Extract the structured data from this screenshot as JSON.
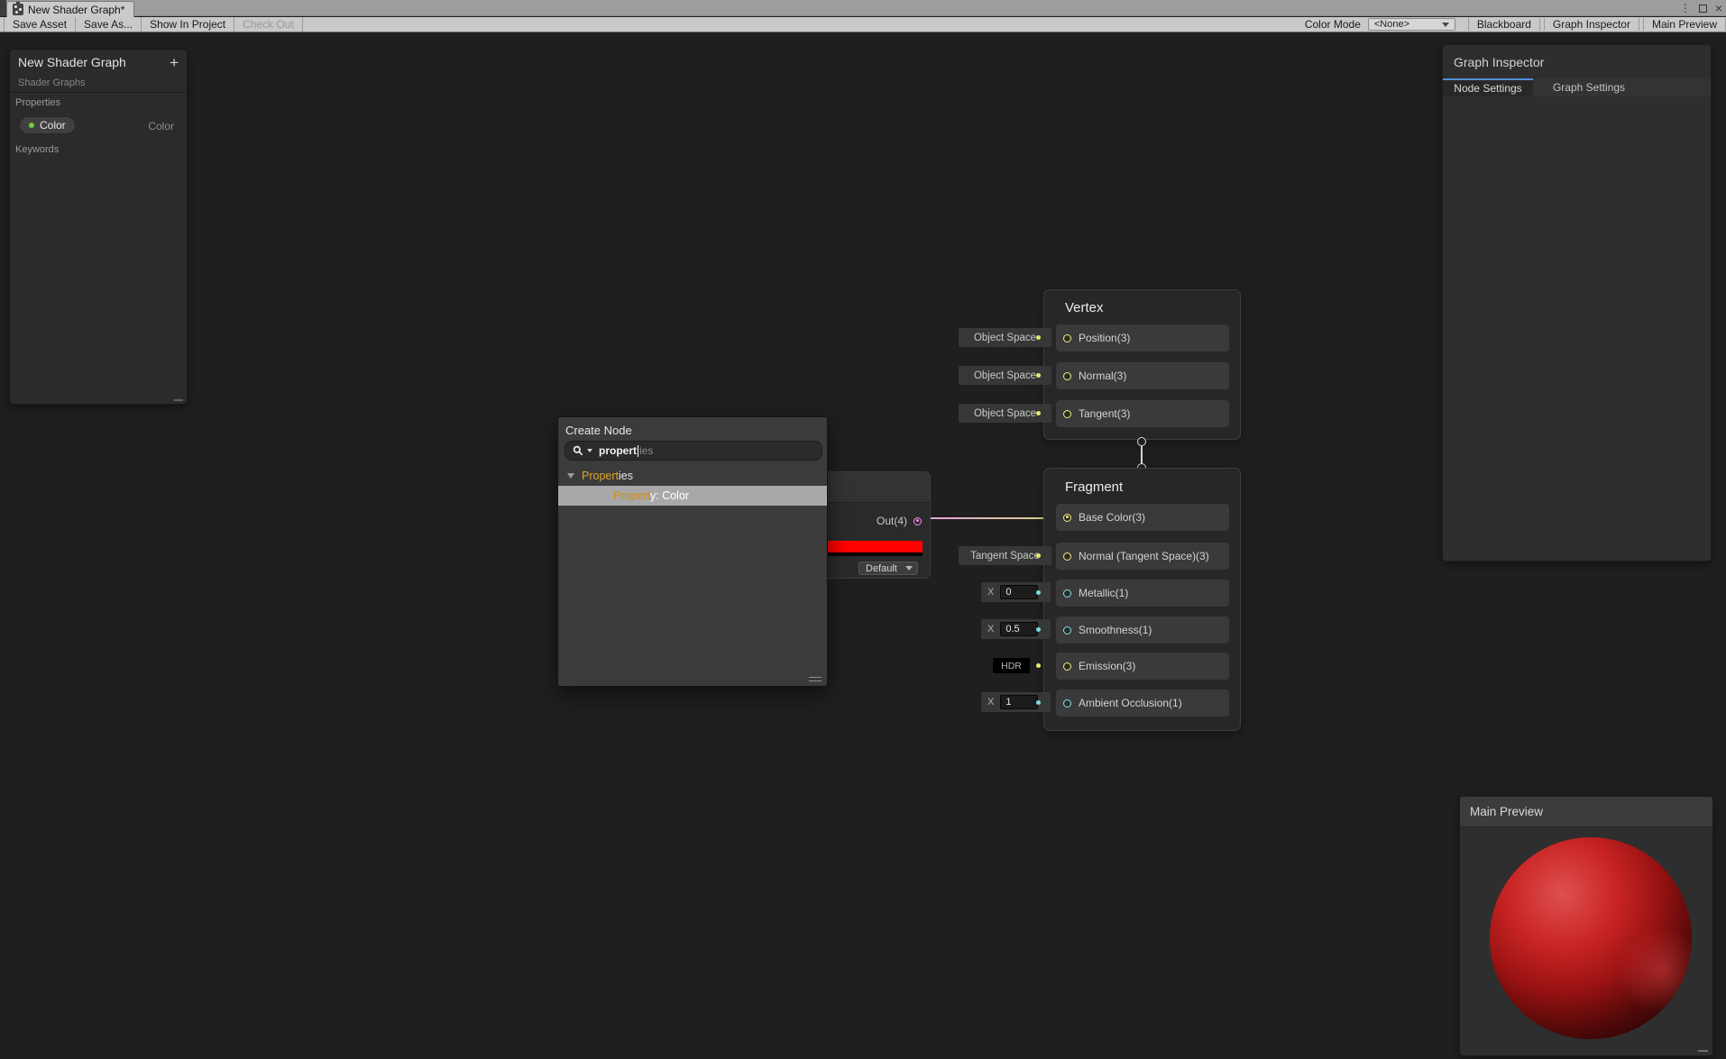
{
  "titlebar": {
    "tab_title": "New Shader Graph*",
    "controls": {
      "menu": "⋮",
      "close": "×"
    }
  },
  "toolbar": {
    "save_asset": "Save Asset",
    "save_as": "Save As...",
    "show_in_project": "Show In Project",
    "check_out": "Check Out",
    "color_mode_label": "Color Mode",
    "color_mode_value": "<None>",
    "blackboard_btn": "Blackboard",
    "graph_inspector_btn": "Graph Inspector",
    "main_preview_btn": "Main Preview"
  },
  "blackboard": {
    "title": "New Shader Graph",
    "subtitle": "Shader Graphs",
    "add_button": "+",
    "properties_label": "Properties",
    "keywords_label": "Keywords",
    "property": {
      "name": "Color",
      "type": "Color",
      "dot_color": "#72cf3a"
    }
  },
  "inspector": {
    "title": "Graph Inspector",
    "tabs": [
      {
        "label": "Node Settings",
        "active": true
      },
      {
        "label": "Graph Settings",
        "active": false
      }
    ]
  },
  "create_node": {
    "title": "Create Node",
    "search_typed": "propert",
    "search_suggestion": "ies",
    "group": {
      "match": "Propert",
      "rest": "ies"
    },
    "item": {
      "match": "Propert",
      "rest": "y: Color"
    }
  },
  "color_node": {
    "out_label": "Out(4)",
    "swatch_color": "#fe0100",
    "dropdown_value": "Default"
  },
  "vertex_node": {
    "title": "Vertex",
    "slots": [
      {
        "label": "Position(3)",
        "binding": "Object Space",
        "type": "vec3"
      },
      {
        "label": "Normal(3)",
        "binding": "Object Space",
        "type": "vec3"
      },
      {
        "label": "Tangent(3)",
        "binding": "Object Space",
        "type": "vec3"
      }
    ]
  },
  "fragment_node": {
    "title": "Fragment",
    "value_prefix": "X",
    "slots": [
      {
        "label": "Base Color(3)",
        "type": "vec3",
        "connected": true
      },
      {
        "label": "Normal (Tangent Space)(3)",
        "binding": "Tangent Space",
        "type": "vec3"
      },
      {
        "label": "Metallic(1)",
        "value": "0",
        "type": "float"
      },
      {
        "label": "Smoothness(1)",
        "value": "0.5",
        "type": "float"
      },
      {
        "label": "Emission(3)",
        "hdr_badge": "HDR",
        "type": "vec3"
      },
      {
        "label": "Ambient Occlusion(1)",
        "value": "1",
        "type": "float"
      }
    ]
  },
  "preview": {
    "title": "Main Preview",
    "sphere_color": "#c92424"
  },
  "colors": {
    "tab_accent": "#4f90d9",
    "port_vec3": "#f3f379",
    "port_float": "#84e8e8",
    "port_vec4": "#f78ff0",
    "wire_from": "#e79fe1",
    "wire_to": "#d8d87f",
    "search_highlight": "#e2a32c",
    "canvas_bg": "#1f1f1f",
    "toolbar_bg": "#c9c9c9"
  }
}
